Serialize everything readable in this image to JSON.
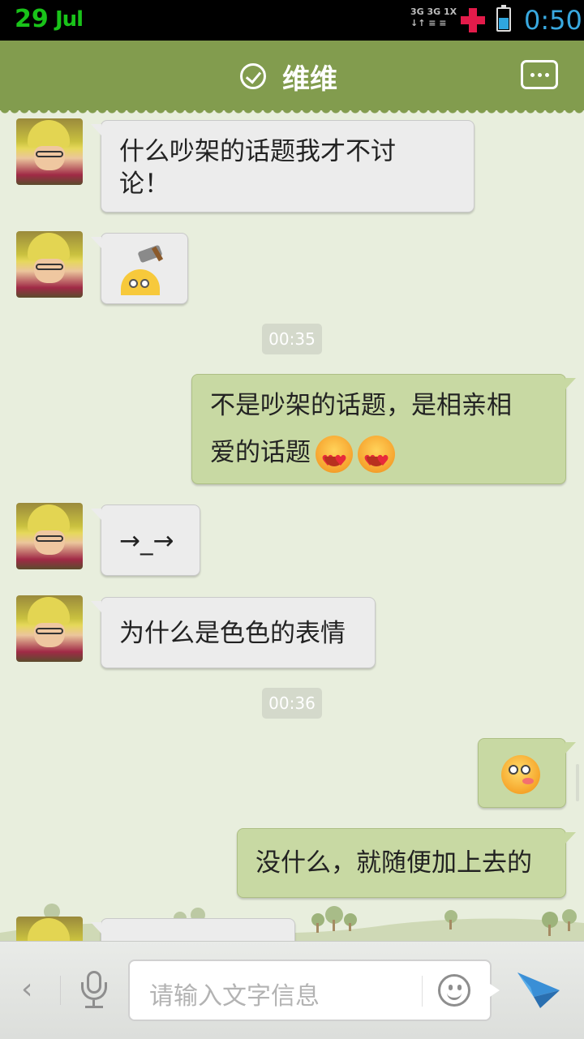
{
  "status_bar": {
    "day": "29",
    "month": "Jul",
    "network_top": "3G 3G 1X",
    "time": "0:50",
    "battery_level_percent": 55,
    "colors": {
      "date": "#19c319",
      "time": "#39a9e0",
      "plus": "#e31b4a"
    }
  },
  "header": {
    "title": "维维",
    "verified_icon": "check-circle-icon",
    "more_icon": "more-dots-icon",
    "color": "#829c4e"
  },
  "messages": [
    {
      "side": "left",
      "text_line1": "什么吵架的话题我才不讨",
      "text_line2": "论！"
    },
    {
      "side": "left",
      "sticker": "axe-head-sticker"
    },
    {
      "timestamp": "00:35"
    },
    {
      "side": "right",
      "text_line1": "不是吵架的话题，是相亲相",
      "text_line2": "爱的话题",
      "emojis": [
        "heart-eyes-emoji",
        "heart-eyes-emoji"
      ]
    },
    {
      "side": "left",
      "text": "→_→"
    },
    {
      "side": "left",
      "text": "为什么是色色的表情"
    },
    {
      "timestamp": "00:36"
    },
    {
      "side": "right",
      "sticker": "blushing-emoji"
    },
    {
      "side": "right",
      "text": "没什么，就随便加上去的"
    }
  ],
  "input_bar": {
    "back_label": "‹",
    "placeholder": "请输入文字信息",
    "icons": [
      "back-chevron-icon",
      "microphone-icon",
      "smiley-icon",
      "send-icon"
    ]
  },
  "theme": {
    "chat_bg": "#e8eedd",
    "left_bubble": "#ececec",
    "right_bubble": "#c8d9a3"
  }
}
